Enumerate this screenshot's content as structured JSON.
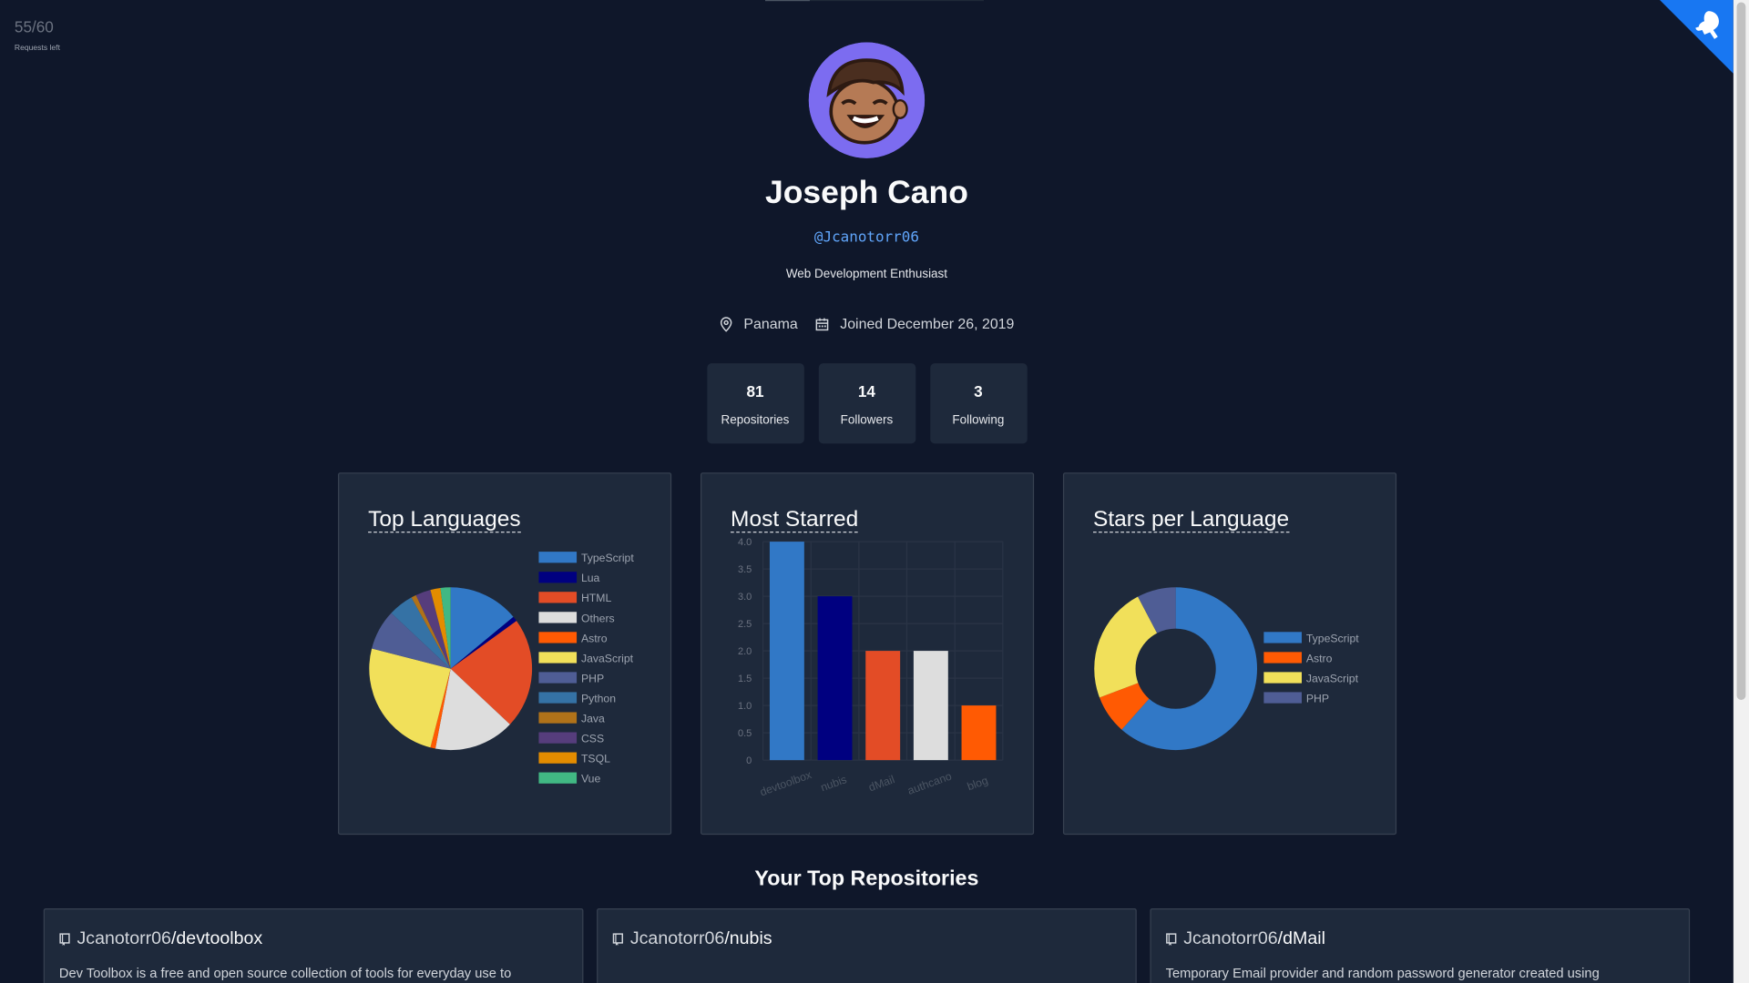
{
  "rate_limit": {
    "count": "55/60",
    "label": "Requests left"
  },
  "profile": {
    "name": "Joseph Cano",
    "handle": "@Jcanotorr06",
    "bio": "Web Development Enthusiast",
    "location": "Panama",
    "joined": "Joined December 26, 2019"
  },
  "stats": [
    {
      "value": "81",
      "label": "Repositories"
    },
    {
      "value": "14",
      "label": "Followers"
    },
    {
      "value": "3",
      "label": "Following"
    }
  ],
  "cards": {
    "top_languages": "Top Languages",
    "most_starred": "Most Starred",
    "stars_per_language": "Stars per Language"
  },
  "chart_data": [
    {
      "type": "pie",
      "title": "Top Languages",
      "legend_position": "right",
      "labels": [
        "TypeScript",
        "Lua",
        "HTML",
        "Others",
        "Astro",
        "JavaScript",
        "PHP",
        "Python",
        "Java",
        "CSS",
        "TSQL",
        "Vue"
      ],
      "values": [
        14,
        1,
        22,
        16,
        1,
        25,
        8,
        5,
        1,
        3,
        2,
        2
      ],
      "colors": [
        "#3178c6",
        "#000080",
        "#e34c26",
        "#dddddd",
        "#ff5a03",
        "#f1e05a",
        "#4f5d95",
        "#3572a5",
        "#b07219",
        "#563d7c",
        "#e38c00",
        "#41b883"
      ]
    },
    {
      "type": "bar",
      "title": "Most Starred",
      "categories": [
        "devtoolbox",
        "nubis",
        "dMail",
        "authcano",
        "blog"
      ],
      "values": [
        4,
        3,
        2,
        2,
        1
      ],
      "colors": [
        "#3178c6",
        "#000080",
        "#e34c26",
        "#dddddd",
        "#ff5a03"
      ],
      "ylim": [
        0,
        4
      ],
      "yticks": [
        "0",
        "0.5",
        "1.0",
        "1.5",
        "2.0",
        "2.5",
        "3.0",
        "3.5",
        "4.0"
      ],
      "grid": true
    },
    {
      "type": "pie",
      "title": "Stars per Language",
      "donut": true,
      "legend_position": "right",
      "labels": [
        "TypeScript",
        "Astro",
        "JavaScript",
        "PHP"
      ],
      "values": [
        8,
        1,
        3,
        1
      ],
      "colors": [
        "#3178c6",
        "#ff5a03",
        "#f1e05a",
        "#4f5d95"
      ]
    }
  ],
  "top_repos_title": "Your Top Repositories",
  "repos": [
    {
      "owner": "Jcanotorr06",
      "name": "devtoolbox",
      "desc": "Dev Toolbox is a free and open source collection of tools for everyday use to"
    },
    {
      "owner": "Jcanotorr06",
      "name": "nubis",
      "desc": ""
    },
    {
      "owner": "Jcanotorr06",
      "name": "dMail",
      "desc": "Temporary Email provider and random password generator created using"
    }
  ],
  "icons": [
    "github-corner-icon",
    "location-pin-icon",
    "calendar-icon",
    "repo-icon"
  ]
}
